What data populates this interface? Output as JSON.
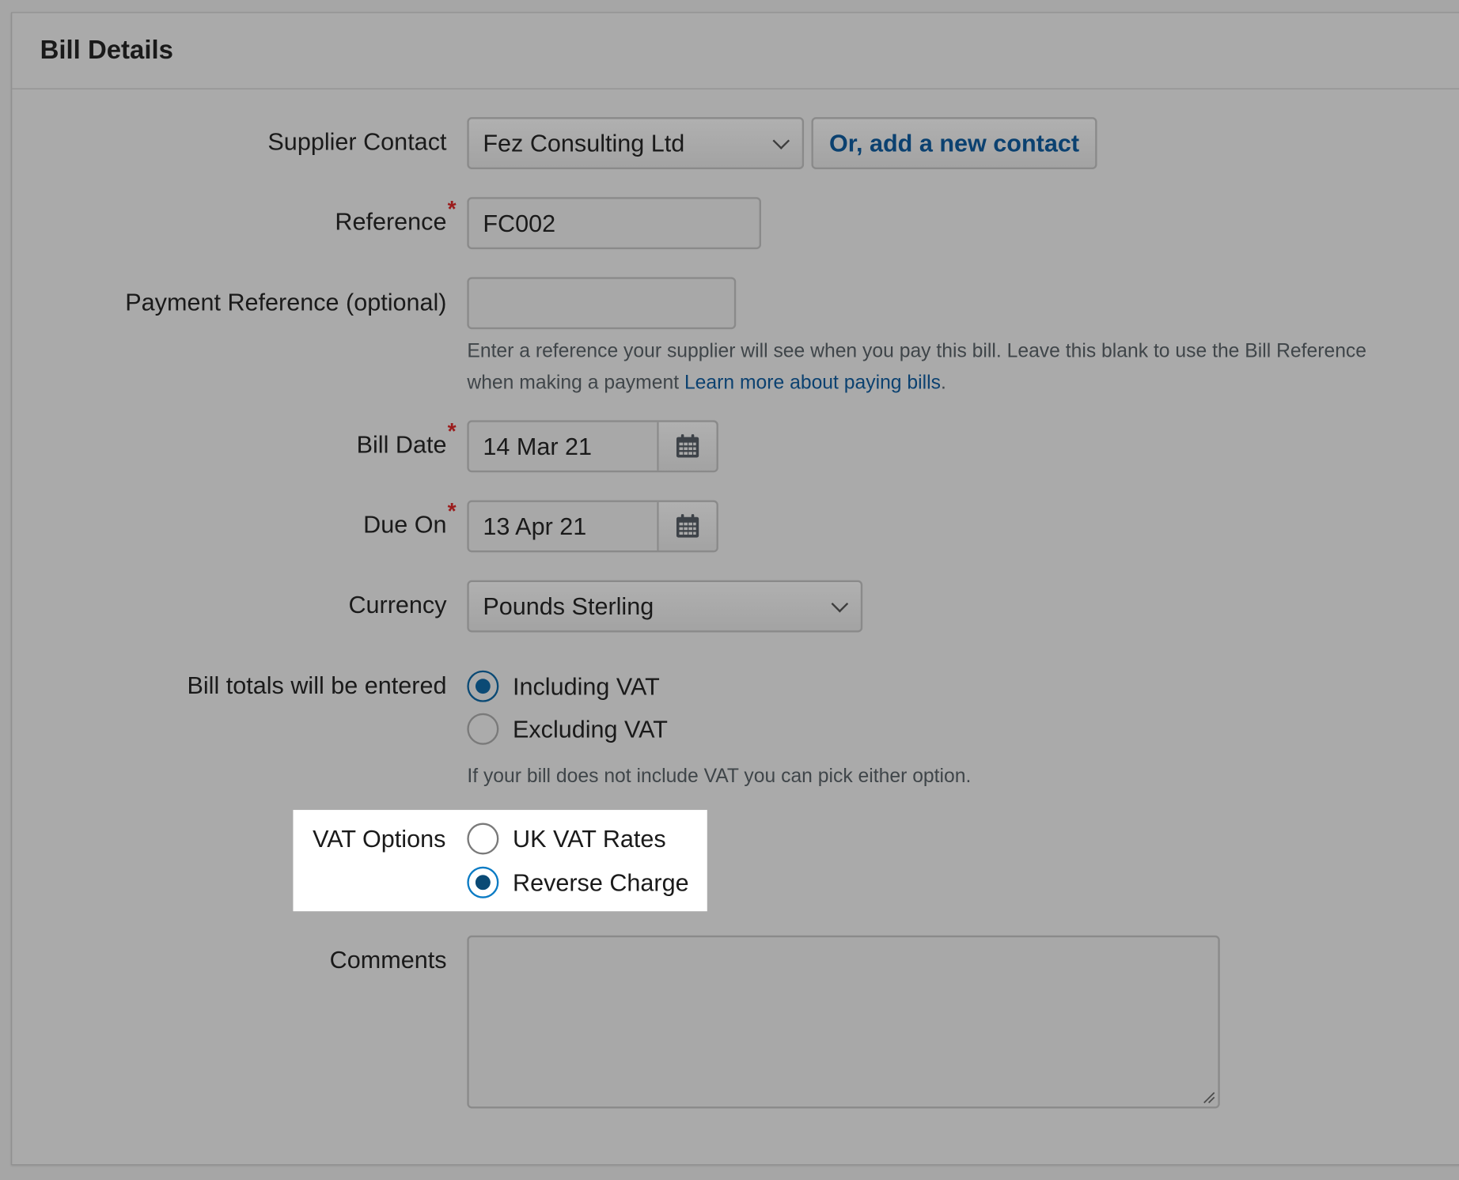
{
  "panel": {
    "title": "Bill Details"
  },
  "supplier_contact": {
    "label": "Supplier Contact",
    "selected": "Fez Consulting Ltd",
    "add_button": "Or, add a new contact"
  },
  "reference": {
    "label": "Reference",
    "required_mark": "*",
    "value": "FC002"
  },
  "payment_reference": {
    "label": "Payment Reference (optional)",
    "value": "",
    "help_line1": "Enter a reference your supplier will see when you pay this bill. Leave this blank to use the Bill Reference",
    "help_line2": "when making a payment",
    "help_link": "Learn more about paying bills",
    "help_end": "."
  },
  "bill_date": {
    "label": "Bill Date",
    "required_mark": "*",
    "value": "14 Mar 21"
  },
  "due_on": {
    "label": "Due On",
    "required_mark": "*",
    "value": "13 Apr 21"
  },
  "currency": {
    "label": "Currency",
    "selected": "Pounds Sterling"
  },
  "bill_totals": {
    "label": "Bill totals will be entered",
    "options": [
      {
        "label": "Including VAT",
        "checked": true
      },
      {
        "label": "Excluding VAT",
        "checked": false
      }
    ],
    "help": "If your bill does not include VAT you can pick either option."
  },
  "vat_options": {
    "label": "VAT Options",
    "options": [
      {
        "label": "UK VAT Rates",
        "checked": false
      },
      {
        "label": "Reverse Charge",
        "checked": true
      }
    ]
  },
  "comments": {
    "label": "Comments",
    "value": ""
  },
  "icons": {
    "calendar": "calendar-icon",
    "dropdown": "chevron-down-icon",
    "resize": "resize-handle-icon"
  },
  "colors": {
    "link": "#0b4170",
    "required": "#9b1c1c",
    "radio_selected": "#0b4a75",
    "radio_selected_highlight": "#0a7bc4",
    "overlay_background": "#a6a6a6",
    "highlight_background": "#ffffff"
  }
}
